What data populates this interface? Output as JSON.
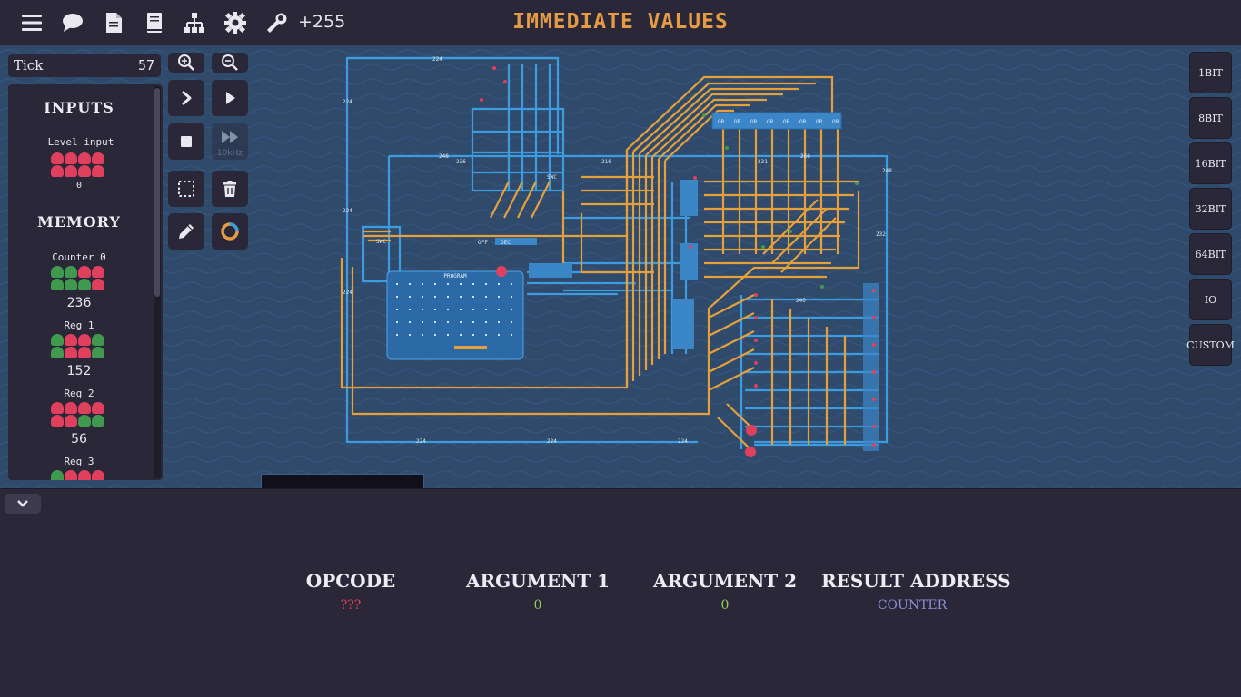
{
  "topbar": {
    "score": "+255",
    "title": "IMMEDIATE VALUES",
    "icons": [
      "menu-icon",
      "chat-icon",
      "document-icon",
      "book-icon",
      "hierarchy-icon",
      "gear-icon",
      "wrench-icon"
    ]
  },
  "tick": {
    "label": "Tick",
    "value": "57"
  },
  "inputs": {
    "title": "INPUTS",
    "level_input": {
      "label": "Level input",
      "value": "0",
      "bits": [
        0,
        0,
        0,
        0,
        0,
        0,
        0,
        0
      ]
    }
  },
  "memory": {
    "title": "MEMORY",
    "items": [
      {
        "label": "Counter 0",
        "value": "236",
        "bits": [
          1,
          1,
          0,
          0,
          1,
          1,
          1,
          0
        ]
      },
      {
        "label": "Reg 1",
        "value": "152",
        "bits": [
          1,
          0,
          0,
          1,
          1,
          0,
          0,
          1
        ]
      },
      {
        "label": "Reg 2",
        "value": "56",
        "bits": [
          0,
          0,
          0,
          0,
          0,
          0,
          1,
          1
        ]
      },
      {
        "label": "Reg 3",
        "value": "",
        "bits": [
          1,
          0,
          0,
          0
        ]
      }
    ]
  },
  "tools": {
    "speed_label": "10kHz"
  },
  "component_buttons": [
    "1BIT",
    "8BIT",
    "16BIT",
    "32BIT",
    "64BIT",
    "IO",
    "CUSTOM"
  ],
  "circuit": {
    "program_label": "PROGRAM",
    "labels": [
      "224",
      "248",
      "236",
      "232",
      "240",
      "231",
      "210",
      "266",
      "268",
      "SWC",
      "OR",
      "DEC",
      "OFF"
    ]
  },
  "info": {
    "columns": [
      {
        "header": "OPCODE",
        "value": "???",
        "color": "#e0405e"
      },
      {
        "header": "ARGUMENT 1",
        "value": "0",
        "color": "#8fd35a"
      },
      {
        "header": "ARGUMENT 2",
        "value": "0",
        "color": "#8fd35a"
      },
      {
        "header": "RESULT ADDRESS",
        "value": "COUNTER",
        "color": "#8a8fd6"
      }
    ]
  },
  "colors": {
    "accent": "#e59a44",
    "wire_orange": "#e6a03a",
    "wire_blue": "#3d9be0",
    "background": "#2f4a6b"
  }
}
